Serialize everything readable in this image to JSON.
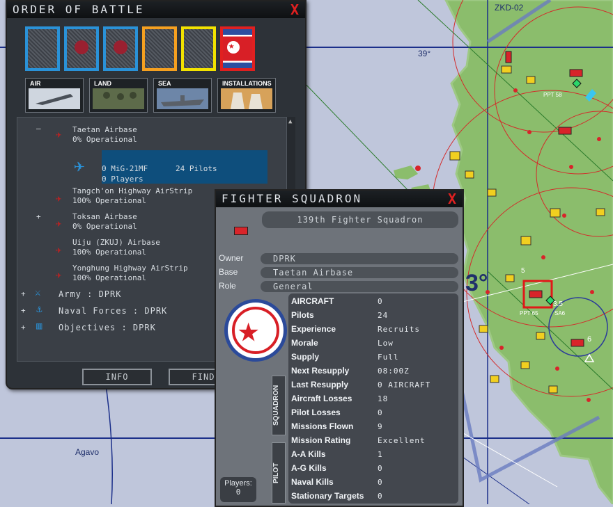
{
  "map": {
    "labels": {
      "zkd02": "ZKD-02",
      "lat39": "39°",
      "lat30": "3°",
      "agavo": "Agavo",
      "ppt58": "PPT 58",
      "ppt65": "PPT 65",
      "sa6": "SA6",
      "n5": "5",
      "n35": "3.5",
      "n6": "6"
    },
    "colors": {
      "sea": "#bfc6db",
      "land": "#8bbd6c",
      "grid": "#1b2f8a",
      "range": "#d42a2a"
    }
  },
  "oob": {
    "title": "ORDER OF BATTLE",
    "categories": [
      "AIR",
      "LAND",
      "SEA",
      "INSTALLATIONS"
    ],
    "tree": {
      "taetan": {
        "name": "Taetan Airbase",
        "status": "0% Operational",
        "expander": "–"
      },
      "selected": {
        "aircraft": "0 MiG-21MF",
        "pilots": "24 Pilots",
        "players": "0 Players"
      },
      "tangchon": {
        "name": "Tangch'on Highway AirStrip",
        "status": "100% Operational"
      },
      "toksan": {
        "name": "Toksan Airbase",
        "status": "0% Operational",
        "expander": "+"
      },
      "uiju": {
        "name": "Uiju  (ZKUJ) Airbase",
        "status": "100% Operational"
      },
      "yonghung": {
        "name": "Yonghung Highway AirStrip",
        "status": "100% Operational"
      },
      "army": "Army : DPRK",
      "naval": "Naval Forces : DPRK",
      "objectives": "Objectives : DPRK"
    },
    "buttons": {
      "info": "INFO",
      "find": "FIND"
    },
    "close": "X"
  },
  "squadron": {
    "title": "FIGHTER SQUADRON",
    "name": "139th Fighter Squadron",
    "owner_label": "Owner",
    "owner": "DPRK",
    "base_label": "Base",
    "base": "Taetan Airbase",
    "role_label": "Role",
    "role": "General",
    "stats": [
      {
        "label": "AIRCRAFT",
        "value": "0"
      },
      {
        "label": "Pilots",
        "value": "24"
      },
      {
        "label": "Experience",
        "value": "Recruits"
      },
      {
        "label": "Morale",
        "value": "Low"
      },
      {
        "label": "Supply",
        "value": "Full"
      },
      {
        "label": "Next Resupply",
        "value": "08:00Z"
      },
      {
        "label": "Last Resupply",
        "value": "0  AIRCRAFT"
      },
      {
        "label": "Aircraft Losses",
        "value": "18"
      },
      {
        "label": "Pilot Losses",
        "value": "0"
      },
      {
        "label": "Missions Flown",
        "value": "9"
      },
      {
        "label": "Mission Rating",
        "value": "Excellent"
      },
      {
        "label": "A-A Kills",
        "value": "1"
      },
      {
        "label": "A-G Kills",
        "value": "0"
      },
      {
        "label": "Naval Kills",
        "value": "0"
      },
      {
        "label": "Stationary Targets",
        "value": "0"
      }
    ],
    "tabs": {
      "squadron": "SQUADRON",
      "pilot": "PILOT"
    },
    "players_label": "Players:",
    "players_value": "0",
    "close": "X"
  }
}
